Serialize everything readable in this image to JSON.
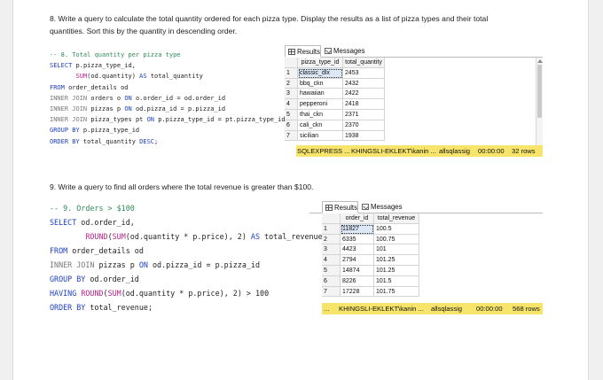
{
  "q8": {
    "line1": "8. Write a query to calculate the total quantity ordered for each pizza type. Display the results as a list of pizza types and their total",
    "line2": "quantities. Sort this by the quantity in descending order."
  },
  "code8": {
    "comment": "-- 8. Total quantity per pizza type",
    "select": "SELECT",
    "select_rest": " p.pizza_type_id,",
    "sum": "SUM",
    "sum_arg": "(od.quantity)",
    "as": " AS",
    "as_rest": " total_quantity",
    "from": "FROM",
    "from_rest": " order_details od",
    "j1": "INNER JOIN",
    "j1_a": " orders o ",
    "on": "ON",
    "j1_b": " o.order_id = od.order_id",
    "j2_a": " pizzas p ",
    "j2_b": " od.pizza_id = p.pizza_id",
    "j3_a": " pizza_types pt ",
    "j3_b": " p.pizza_type_id = pt.pizza_type_id",
    "group": "GROUP BY",
    "group_rest": " p.pizza_type_id",
    "order": "ORDER BY",
    "order_rest": " total_quantity ",
    "desc": "DESC",
    "semi": ";"
  },
  "res8": {
    "tab_results": "Results",
    "tab_messages": "Messages",
    "columns": [
      "pizza_type_id",
      "total_quantity"
    ],
    "rows": [
      [
        "1",
        "classic_dlx",
        "2453"
      ],
      [
        "2",
        "bbq_ckn",
        "2432"
      ],
      [
        "3",
        "hawaiian",
        "2422"
      ],
      [
        "4",
        "pepperoni",
        "2418"
      ],
      [
        "5",
        "thai_ckn",
        "2371"
      ],
      [
        "6",
        "cali_ckn",
        "2370"
      ],
      [
        "7",
        "sicilian",
        "1938"
      ]
    ],
    "status": {
      "server": "SQLEXPRESS ...",
      "user": "KHINGSLI-EKLEKT\\kanin ...",
      "db": "allsqlassig",
      "time": "00:00:00",
      "rows": "32 rows"
    }
  },
  "q9": {
    "line1": "9. Write a query to find all orders where the total revenue is greater than $100."
  },
  "code9": {
    "comment": "-- 9. Orders > $100",
    "select": "SELECT",
    "select_rest": " od.order_id,",
    "round": "ROUND",
    "sum": "SUM",
    "expr": "(od.quantity * p.price), 2)",
    "as": " AS",
    "as_rest": " total_revenue",
    "from": "FROM",
    "from_rest": " order_details od",
    "join": "INNER JOIN",
    "join_a": " pizzas p ",
    "on": "ON",
    "join_b": " od.pizza_id = p.pizza_id",
    "group": "GROUP BY",
    "group_rest": " od.order_id",
    "having": "HAVING",
    "having_expr": "(od.quantity * p.price), 2) > 100",
    "order": "ORDER BY",
    "order_rest": " total_revenue",
    "semi": ";"
  },
  "res9": {
    "tab_results": "Results",
    "tab_messages": "Messages",
    "columns": [
      "order_id",
      "total_revenue"
    ],
    "rows": [
      [
        "1",
        "11827",
        "100.5"
      ],
      [
        "2",
        "6335",
        "100.75"
      ],
      [
        "3",
        "4423",
        "101"
      ],
      [
        "4",
        "2794",
        "101.25"
      ],
      [
        "5",
        "14874",
        "101.25"
      ],
      [
        "6",
        "8226",
        "101.5"
      ],
      [
        "7",
        "17228",
        "101.75"
      ]
    ],
    "status": {
      "server": "...",
      "user": "KHINGSLI-EKLEKT\\kanin ...",
      "db": "allsqlassig",
      "time": "00:00:00",
      "rows": "568 rows"
    }
  }
}
